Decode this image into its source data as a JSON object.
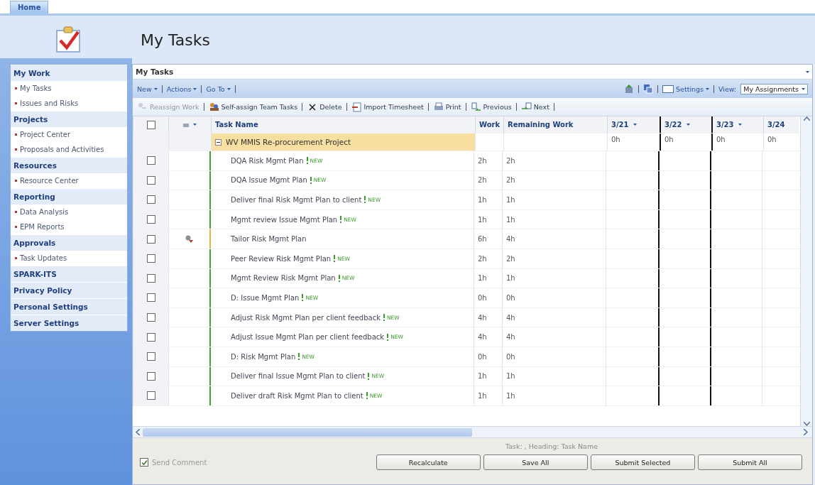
{
  "tabs": [
    {
      "label": "Home",
      "selected": true
    }
  ],
  "page_title": "My Tasks",
  "sidebar": {
    "sections": [
      {
        "title": "My Work",
        "items": [
          "My Tasks",
          "Issues and Risks"
        ]
      },
      {
        "title": "Projects",
        "items": [
          "Project Center",
          "Proposals and Activities"
        ]
      },
      {
        "title": "Resources",
        "items": [
          "Resource Center"
        ]
      },
      {
        "title": "Reporting",
        "items": [
          "Data Analysis",
          "EPM Reports"
        ]
      },
      {
        "title": "Approvals",
        "items": [
          "Task Updates"
        ]
      },
      {
        "title": "SPARK-ITS"
      },
      {
        "title": "Privacy Policy"
      },
      {
        "title": "Personal Settings"
      },
      {
        "title": "Server Settings"
      }
    ]
  },
  "list_title": "My Tasks",
  "menu_bar": {
    "menus": [
      "New",
      "Actions",
      "Go To"
    ],
    "settings": "Settings",
    "view_label": "View:",
    "view_value": "My Assignments"
  },
  "action_bar": [
    {
      "label": "Reassign Work",
      "kind": "reassign",
      "disabled": true
    },
    {
      "label": "Self-assign Team Tasks",
      "kind": "people",
      "disabled": false
    },
    {
      "label": "Delete",
      "kind": "delete",
      "disabled": false
    },
    {
      "label": "Import Timesheet",
      "kind": "import",
      "disabled": false
    },
    {
      "label": "Print",
      "kind": "print",
      "disabled": false
    },
    {
      "label": "Previous",
      "kind": "previous",
      "disabled": false
    },
    {
      "label": "Next",
      "kind": "next",
      "disabled": false
    }
  ],
  "table": {
    "select_all_checked": false,
    "columns": [
      {
        "label": "Task Name",
        "kind": "text"
      },
      {
        "label": "Work",
        "kind": "text"
      },
      {
        "label": "Remaining Work",
        "kind": "text"
      },
      {
        "label": "3/21",
        "kind": "date",
        "heavy_left": false
      },
      {
        "label": "3/22",
        "kind": "date",
        "heavy_left": true
      },
      {
        "label": "3/23",
        "kind": "date",
        "heavy_left": true
      },
      {
        "label": "3/24",
        "kind": "date",
        "heavy_left": false
      }
    ],
    "group": {
      "name": "WV MMIS Re-procurement Project",
      "expanded": true,
      "day_totals": [
        "0h",
        "0h",
        "0h",
        "0h"
      ]
    },
    "rows": [
      {
        "name": "DQA Risk Mgmt Plan",
        "badge": "NEW",
        "work": "2h",
        "remaining": "2h",
        "checked": false,
        "flagged": false
      },
      {
        "name": "DQA Issue Mgmt Plan",
        "badge": "NEW",
        "work": "2h",
        "remaining": "2h",
        "checked": false,
        "flagged": false
      },
      {
        "name": "Deliver final Risk Mgmt Plan to client",
        "badge": "NEW",
        "work": "1h",
        "remaining": "1h",
        "checked": false,
        "flagged": false
      },
      {
        "name": "Mgmt review Issue Mgmt Plan",
        "badge": "NEW",
        "work": "1h",
        "remaining": "1h",
        "checked": false,
        "flagged": false
      },
      {
        "name": "Tailor Risk Mgmt Plan",
        "work": "6h",
        "remaining": "4h",
        "checked": false,
        "flagged": true
      },
      {
        "name": "Peer Review Risk Mgmt Plan",
        "badge": "NEW",
        "work": "2h",
        "remaining": "2h",
        "checked": false,
        "flagged": false
      },
      {
        "name": "Mgmt Review Risk Mgmt Plan",
        "badge": "NEW",
        "work": "1h",
        "remaining": "1h",
        "checked": false,
        "flagged": false
      },
      {
        "name": "D: Issue Mgmt Plan",
        "badge": "NEW",
        "work": "0h",
        "remaining": "0h",
        "checked": false,
        "flagged": false
      },
      {
        "name": "Adjust Risk Mgmt Plan per client feedback",
        "badge": "NEW",
        "work": "4h",
        "remaining": "4h",
        "checked": false,
        "flagged": false
      },
      {
        "name": "Adjust Issue Mgmt Plan per client feedback",
        "badge": "NEW",
        "work": "4h",
        "remaining": "4h",
        "checked": false,
        "flagged": false
      },
      {
        "name": "D: Risk Mgmt Plan",
        "badge": "NEW",
        "work": "0h",
        "remaining": "0h",
        "checked": false,
        "flagged": false
      },
      {
        "name": "Deliver final Issue Mgmt Plan to client",
        "badge": "NEW",
        "work": "1h",
        "remaining": "1h",
        "checked": false,
        "flagged": false
      },
      {
        "name": "Deliver draft Risk Mgmt Plan to client",
        "badge": "NEW",
        "work": "1h",
        "remaining": "1h",
        "checked": false,
        "flagged": false
      }
    ]
  },
  "footer": {
    "status": "Task: , Heading: Task Name",
    "send_comment": {
      "label": "Send Comment",
      "checked": true,
      "disabled": true
    },
    "buttons": [
      "Recalculate",
      "Save All",
      "Submit Selected",
      "Submit All"
    ]
  }
}
